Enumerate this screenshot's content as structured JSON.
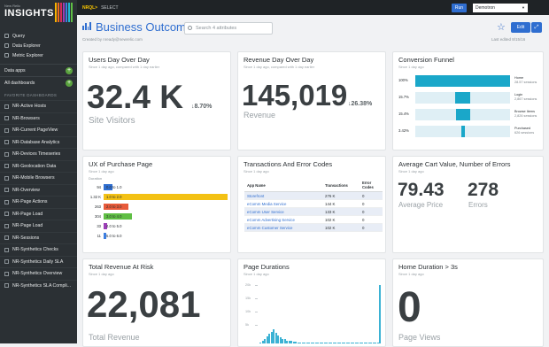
{
  "sidebar": {
    "brand_small": "New Relic",
    "brand_title": "INSIGHTS",
    "stripe_colors": [
      "#f9b200",
      "#f06b1f",
      "#d62d58",
      "#9b3eb6",
      "#3c7ee0",
      "#1fb8d0",
      "#5fbf44"
    ],
    "nav": [
      {
        "label": "Query",
        "icon": "query-icon"
      },
      {
        "label": "Data Explorer",
        "icon": "explorer-icon"
      },
      {
        "label": "Metric Explorer",
        "icon": "metric-icon"
      }
    ],
    "data_apps": "Data apps",
    "all_dashboards": "All dashboards",
    "favorites_title": "FAVORITE DASHBOARDS",
    "favorites": [
      "NR-Active Hosts",
      "NR-Browsers",
      "NR-Current PageView",
      "NR-Database Analytics",
      "NR-Devices Timeseries",
      "NR-Geolocation Data",
      "NR-Mobile Browsers",
      "NR-Overview",
      "NR-Page Actions",
      "NR-Page Load",
      "NR-Page Load",
      "NR-Sessions",
      "NR-Synthetics Checks",
      "NR-Synthetics Daily SLA",
      "NR-Synthetics Overview",
      "NR-Synthetics SLA Compli..."
    ]
  },
  "topbar": {
    "nrql": "NRQL>",
    "select": "SELECT",
    "run": "Run",
    "account": "Demotron"
  },
  "header": {
    "title": "Business Outcomes",
    "search_placeholder": "Search 4 attributes",
    "created_by": "Created by nready@newrelic.com",
    "edit": "Edit",
    "last_edited": "Last edited 8/15/16"
  },
  "cards": {
    "users": {
      "title": "Users Day Over Day",
      "sub": "Since 1 day ago, compared with 1 day earlier",
      "value": "32.4 K",
      "delta": "↓8.70%",
      "label": "Site Visitors"
    },
    "revenue": {
      "title": "Revenue Day Over Day",
      "sub": "Since 1 day ago, compared with 1 day earlier",
      "value": "145,019",
      "delta": "↓26.38%",
      "label": "Revenue"
    },
    "funnel": {
      "title": "Conversion Funnel",
      "sub": "Since 1 day ago",
      "rows": [
        {
          "pct": "100%",
          "name": "Home",
          "count": "28.57 sessions",
          "fill": 1.0
        },
        {
          "pct": "15.7%",
          "name": "Login",
          "count": "2,867 sessions",
          "fill": 0.157
        },
        {
          "pct": "15.4%",
          "name": "Browse Items",
          "count": "2,826 sessions",
          "fill": 0.154
        },
        {
          "pct": "3.42%",
          "name": "Purchased",
          "count": "626 sessions",
          "fill": 0.0342
        }
      ]
    },
    "ux": {
      "title": "UX of Purchase Page",
      "sub": "Since 1 day ago",
      "axis_label": "Duration",
      "rows": [
        {
          "count": "94",
          "range": "0.0 to 1.0",
          "color": "#2f6ed0",
          "value": 94
        },
        {
          "count": "1.32 K",
          "range": "1.0 to 2.0",
          "color": "#f3c114",
          "value": 1320
        },
        {
          "count": "263",
          "range": "2.0 to 3.0",
          "color": "#e85a3a",
          "value": 263
        },
        {
          "count": "304",
          "range": "3.0 to 4.0",
          "color": "#5fbf44",
          "value": 304
        },
        {
          "count": "33",
          "range": "4.0 to 5.0",
          "color": "#9b3eb6",
          "value": 33
        },
        {
          "count": "11",
          "range": "5.0 to 6.0",
          "color": "#3c7ee0",
          "value": 11
        }
      ]
    },
    "transactions": {
      "title": "Transactions And Error Codes",
      "sub": "Since 1 day ago",
      "columns": [
        "App Name",
        "Transactions",
        "Error Codes"
      ],
      "rows": [
        [
          "Storefront",
          "276 K",
          "0"
        ],
        [
          "eComm Media Service",
          "144 K",
          "0"
        ],
        [
          "eComm User Service",
          "133 K",
          "0"
        ],
        [
          "eComm Advertising Service",
          "102 K",
          "0"
        ],
        [
          "eComm Customer Service",
          "102 K",
          "0"
        ]
      ]
    },
    "cart": {
      "title": "Average Cart Value, Number of Errors",
      "sub": "Since 1 day ago",
      "value1": "79.43",
      "label1": "Average Price",
      "value2": "278",
      "label2": "Errors"
    },
    "risk": {
      "title": "Total Revenue At Risk",
      "sub": "Since 1 day ago",
      "value": "22,081",
      "label": "Total Revenue"
    },
    "durations": {
      "title": "Page Durations",
      "sub": "Since 1 day ago",
      "y_ticks": [
        "20k",
        "15k",
        "10k",
        "5k"
      ],
      "bars": [
        0.02,
        0.05,
        0.08,
        0.12,
        0.16,
        0.2,
        0.24,
        0.18,
        0.14,
        0.1,
        0.08,
        0.07,
        0.05,
        0.04,
        0.04,
        0.03,
        0.03,
        0.02,
        0.02,
        0.02,
        0.02,
        0.01,
        0.01,
        0.01,
        0.01,
        0.01,
        0.01,
        0.01,
        0.01,
        0.01,
        0.01,
        0.01,
        0.01,
        0.01,
        0.01,
        0.01,
        0.01,
        0.01,
        0.01,
        0.01,
        0.01,
        0.01,
        0.01,
        0.01,
        0.01,
        0.01,
        0.01,
        0.01,
        0.01,
        0.01,
        0.01,
        0.01,
        0.01,
        0.01,
        1.0
      ]
    },
    "home": {
      "title": "Home Duration > 3s",
      "sub": "Since 1 day ago",
      "value": "0",
      "label": "Page Views"
    }
  }
}
